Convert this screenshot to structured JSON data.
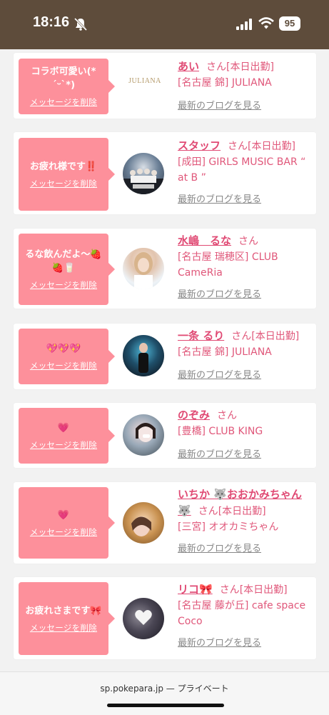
{
  "status_bar": {
    "time": "18:16",
    "battery": "95",
    "icons": [
      "bell-muted-icon",
      "signal-icon",
      "wifi-icon",
      "battery-icon"
    ]
  },
  "cards": [
    {
      "message": "コラボ可愛い(*´ᵕ`*)",
      "delete_label": "メッセージを削除",
      "name": "あい",
      "honorific": "さん",
      "status": "[本日出勤]",
      "shop": "[名古屋 錦] JULIANA",
      "blog_label": "最新のブログを見る",
      "avatar_text": "JULIANA"
    },
    {
      "message": "お疲れ様です‼️",
      "delete_label": "メッセージを削除",
      "name": "スタッフ",
      "honorific": "さん",
      "status": "[本日出勤]",
      "shop": "[成田] GIRLS MUSIC BAR “ at B ”",
      "blog_label": "最新のブログを見る"
    },
    {
      "message": "るな飲んだよ〜🍓🍓🥛",
      "delete_label": "メッセージを削除",
      "name": "水嶋　るな",
      "honorific": "さん",
      "status": "",
      "shop": "[名古屋 瑞穂区] CLUB CameRia",
      "blog_label": "最新のブログを見る"
    },
    {
      "message": "💖💖💖",
      "delete_label": "メッセージを削除",
      "name": "一条 るり",
      "honorific": "さん",
      "status": "[本日出勤]",
      "shop": "[名古屋 錦] JULIANA",
      "blog_label": "最新のブログを見る"
    },
    {
      "message": "💗",
      "delete_label": "メッセージを削除",
      "name": "のぞみ",
      "honorific": "さん",
      "status": "",
      "shop": "[豊橋] CLUB KING",
      "blog_label": "最新のブログを見る"
    },
    {
      "message": "💗",
      "delete_label": "メッセージを削除",
      "name": "いちか 🐺おおかみちゃん🐺",
      "honorific": "さん",
      "status": "[本日出勤]",
      "shop": "[三宮] オオカミちゃん",
      "blog_label": "最新のブログを見る"
    },
    {
      "message": "お疲れさまです🎀",
      "delete_label": "メッセージを削除",
      "name": "リコ🎀",
      "honorific": "さん",
      "status": "[本日出勤]",
      "shop": "[名古屋 藤が丘] cafe space Coco",
      "blog_label": "最新のブログを見る"
    }
  ],
  "bottom_bar": {
    "url": "sp.pokepara.jp — プライベート"
  },
  "colors": {
    "status_bar_bg": "#5e4c3b",
    "bubble": "#fd909b",
    "name_pink": "#e04a74",
    "background": "#f2f2f2"
  }
}
